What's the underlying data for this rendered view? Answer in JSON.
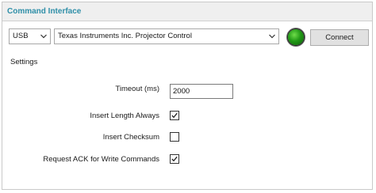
{
  "window": {
    "title": "Command Interface"
  },
  "connection": {
    "interface_value": "USB",
    "device_value": "Texas Instruments Inc. Projector Control",
    "status": "connected",
    "status_color": "#229a17",
    "connect_label": "Connect"
  },
  "settings": {
    "heading": "Settings",
    "timeout": {
      "label": "Timeout (ms)",
      "value": "2000"
    },
    "options": [
      {
        "label": "Insert Length Always",
        "checked": true
      },
      {
        "label": "Insert Checksum",
        "checked": false
      },
      {
        "label": "Request ACK for Write Commands",
        "checked": true
      }
    ]
  },
  "icons": {
    "dropdown": "chevron-down-icon",
    "check": "checkmark-icon",
    "status": "status-led-icon"
  }
}
